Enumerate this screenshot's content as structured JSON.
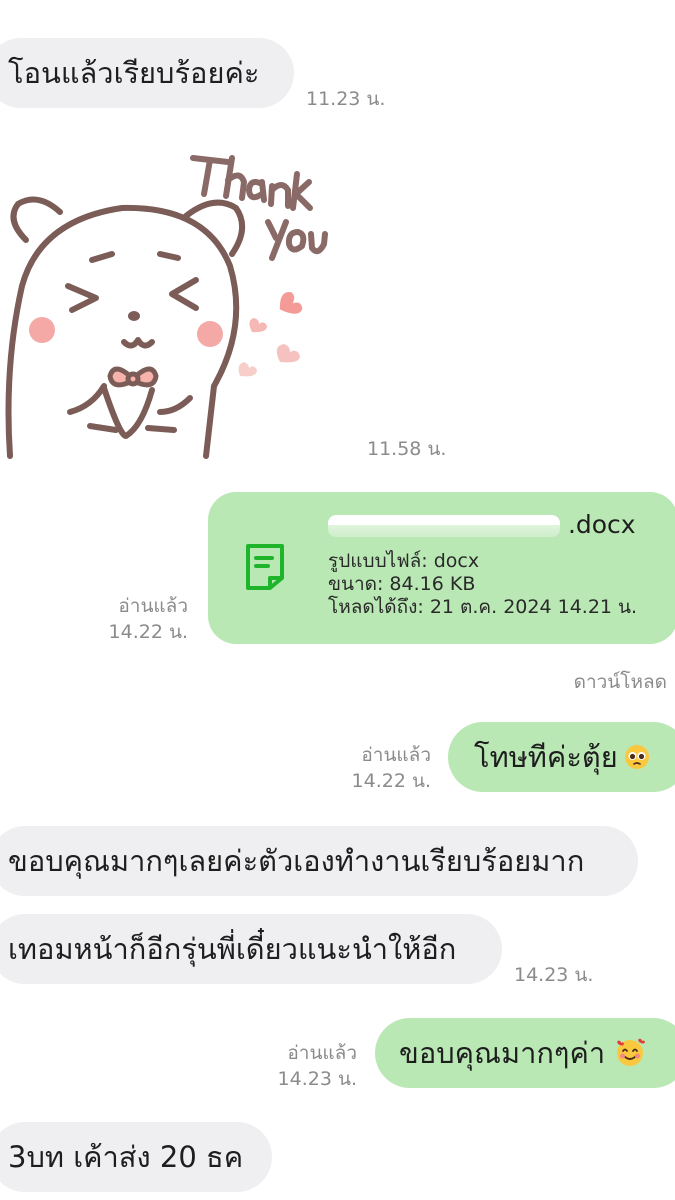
{
  "messages": [
    {
      "id": "m1",
      "text": "โอนแล้วเรียบร้อยค่ะ",
      "time": "11.23 น."
    },
    {
      "id": "m2",
      "sticker": "bear-thank-you-sticker",
      "sticker_text": "Thank you",
      "time": "11.58 น."
    },
    {
      "id": "m3",
      "file": {
        "name_suffix": " .docx",
        "format_line": "รูปแบบไฟล์: docx",
        "size_line": "ขนาด: 84.16 KB",
        "expiry_line": "โหลดได้ถึง: 21 ต.ค. 2024 14.21 น.",
        "icon": "document-icon"
      },
      "read": "อ่านแล้ว",
      "time": "14.22 น.",
      "download": "ดาวน์โหลด"
    },
    {
      "id": "m4",
      "text": "โทษทีค่ะตุ้ย",
      "emoji": "pleading-face",
      "read": "อ่านแล้ว",
      "time": "14.22 น."
    },
    {
      "id": "m5",
      "text": "ขอบคุณมากๆเลยค่ะตัวเองทำงานเรียบร้อยมาก"
    },
    {
      "id": "m6",
      "text": "เทอมหน้าก็อีกรุ่นพี่เดี๋ยวแนะนำให้อีก",
      "time": "14.23 น."
    },
    {
      "id": "m7",
      "text": "ขอบคุณมากๆค่า",
      "emoji": "smiling-face-with-hearts",
      "read": "อ่านแล้ว",
      "time": "14.23 น."
    },
    {
      "id": "m8",
      "text": "3บท เค้าส่ง 20 ธค"
    }
  ],
  "colors": {
    "incoming_bubble": "#efeff1",
    "outgoing_bubble": "#b9e8b4",
    "meta_text": "#8b8b8b",
    "file_icon": "#1fb52b"
  }
}
